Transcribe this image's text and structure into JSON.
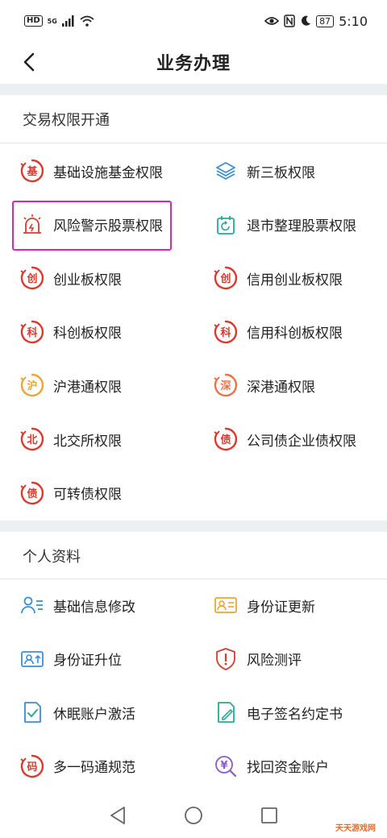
{
  "status_bar": {
    "left_badge": "HD",
    "signal_label": "5G",
    "battery": "87",
    "time": "5:10"
  },
  "header": {
    "title": "业务办理"
  },
  "sections": [
    {
      "title": "交易权限开通",
      "items": [
        {
          "label": "基础设施基金权限",
          "icon": "jichu-badge-icon",
          "glyph": "基",
          "color": "#d93a2f"
        },
        {
          "label": "新三板权限",
          "icon": "layers-icon",
          "color": "#3b8fd1"
        },
        {
          "label": "风险警示股票权限",
          "icon": "alarm-light-icon",
          "color": "#d93a2f"
        },
        {
          "label": "退市整理股票权限",
          "icon": "calendar-refresh-icon",
          "color": "#2aa89a"
        },
        {
          "label": "创业板权限",
          "icon": "chuang-badge-icon",
          "glyph": "创",
          "color": "#d93a2f"
        },
        {
          "label": "信用创业板权限",
          "icon": "chuang-badge-icon",
          "glyph": "创",
          "color": "#d93a2f"
        },
        {
          "label": "科创板权限",
          "icon": "ke-badge-icon",
          "glyph": "科",
          "color": "#d93a2f"
        },
        {
          "label": "信用科创板权限",
          "icon": "ke-badge-icon",
          "glyph": "科",
          "color": "#d93a2f"
        },
        {
          "label": "沪港通权限",
          "icon": "hu-badge-icon",
          "glyph": "沪",
          "color": "#e8a735"
        },
        {
          "label": "深港通权限",
          "icon": "shen-badge-icon",
          "glyph": "深",
          "color": "#e8734a"
        },
        {
          "label": "北交所权限",
          "icon": "bei-badge-icon",
          "glyph": "北",
          "color": "#d93a2f"
        },
        {
          "label": "公司债企业债权限",
          "icon": "zhai-badge-icon",
          "glyph": "债",
          "color": "#d93a2f"
        },
        {
          "label": "可转债权限",
          "icon": "zhai-badge-icon",
          "glyph": "债",
          "color": "#d93a2f"
        }
      ]
    },
    {
      "title": "个人资料",
      "items": [
        {
          "label": "基础信息修改",
          "icon": "user-list-icon",
          "color": "#3b8fd1"
        },
        {
          "label": "身份证更新",
          "icon": "id-card-icon",
          "color": "#e8a735"
        },
        {
          "label": "身份证升位",
          "icon": "id-card-upgrade-icon",
          "color": "#3b8fd1"
        },
        {
          "label": "风险测评",
          "icon": "shield-alert-icon",
          "color": "#d93a2f"
        },
        {
          "label": "休眠账户激活",
          "icon": "doc-check-icon",
          "color": "#3b8fd1"
        },
        {
          "label": "电子签名约定书",
          "icon": "doc-sign-icon",
          "color": "#2aa89a"
        },
        {
          "label": "多一码通规范",
          "icon": "ma-badge-icon",
          "glyph": "码",
          "color": "#d93a2f"
        },
        {
          "label": "找回资金账户",
          "icon": "yuan-search-icon",
          "glyph": "¥",
          "color": "#8a5cc7"
        }
      ]
    }
  ],
  "watermark": "天天游戏网"
}
